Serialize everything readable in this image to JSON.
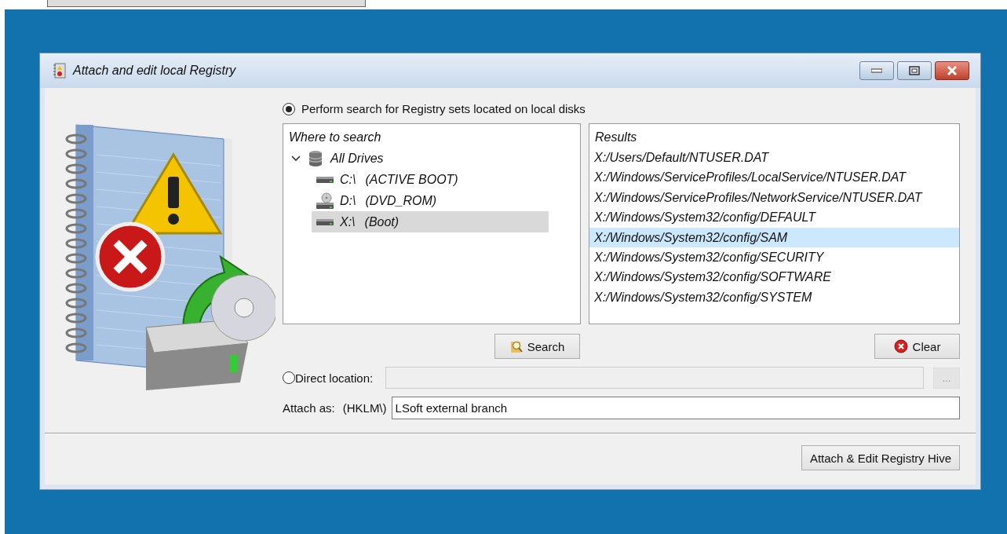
{
  "window": {
    "title": "Attach and edit local Registry",
    "controls": [
      {
        "kind": "minimize"
      },
      {
        "kind": "maximize"
      },
      {
        "kind": "close"
      }
    ]
  },
  "search_option": {
    "label": "Perform search for Registry sets located on local disks",
    "selected": true
  },
  "where_panel": {
    "header": "Where to search",
    "tree": [
      {
        "label": "All Drives",
        "kind": "database",
        "expanded": true,
        "selected": false,
        "children": [
          {
            "label": "C:\\",
            "note": "(ACTIVE BOOT)",
            "kind": "hdd",
            "selected": false
          },
          {
            "label": "D:\\",
            "note": "(DVD_ROM)",
            "kind": "cdrom",
            "selected": false
          },
          {
            "label": "X:\\",
            "note": "(Boot)",
            "kind": "hdd",
            "selected": true
          }
        ]
      }
    ]
  },
  "results_panel": {
    "header": "Results",
    "items": [
      {
        "path": "X:/Users/Default/NTUSER.DAT",
        "selected": false
      },
      {
        "path": "X:/Windows/ServiceProfiles/LocalService/NTUSER.DAT",
        "selected": false
      },
      {
        "path": "X:/Windows/ServiceProfiles/NetworkService/NTUSER.DAT",
        "selected": false
      },
      {
        "path": "X:/Windows/System32/config/DEFAULT",
        "selected": false
      },
      {
        "path": "X:/Windows/System32/config/SAM",
        "selected": true
      },
      {
        "path": "X:/Windows/System32/config/SECURITY",
        "selected": false
      },
      {
        "path": "X:/Windows/System32/config/SOFTWARE",
        "selected": false
      },
      {
        "path": "X:/Windows/System32/config/SYSTEM",
        "selected": false
      }
    ]
  },
  "search_button": {
    "label": "Search"
  },
  "clear_button": {
    "label": "Clear"
  },
  "direct_option": {
    "label": "Direct location:",
    "selected": false
  },
  "direct_field": {
    "disabled": true
  },
  "browse_button": {
    "label": "...",
    "disabled": true
  },
  "attach_as": {
    "label": "Attach as:",
    "prefix": "(HKLM\\)",
    "value": "LSoft external branch"
  },
  "primary_button": {
    "label": "Attach & Edit Registry Hive"
  }
}
